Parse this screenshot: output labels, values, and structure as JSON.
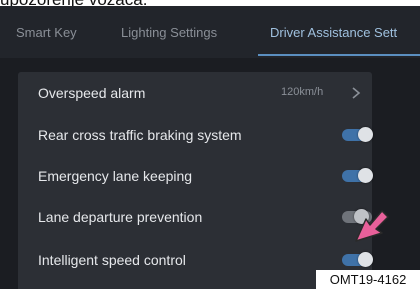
{
  "caption_top": "upozorenje vozača.",
  "tabs": [
    {
      "label": "Smart Key"
    },
    {
      "label": "Lighting Settings"
    },
    {
      "label": "Driver Assistance Sett"
    }
  ],
  "settings": {
    "overspeed_alarm": {
      "label": "Overspeed alarm",
      "value": "120km/h"
    },
    "rear_cross_traffic": {
      "label": "Rear cross traffic braking system",
      "enabled": true
    },
    "emergency_lane_keeping": {
      "label": "Emergency lane keeping",
      "enabled": true
    },
    "lane_departure": {
      "label": "Lane departure prevention",
      "enabled": false
    },
    "intelligent_speed": {
      "label": "Intelligent speed control",
      "enabled": true
    }
  },
  "figure_code": "OMT19-4162",
  "colors": {
    "accent": "#5b8fc0",
    "pointer": "#e8609a"
  }
}
